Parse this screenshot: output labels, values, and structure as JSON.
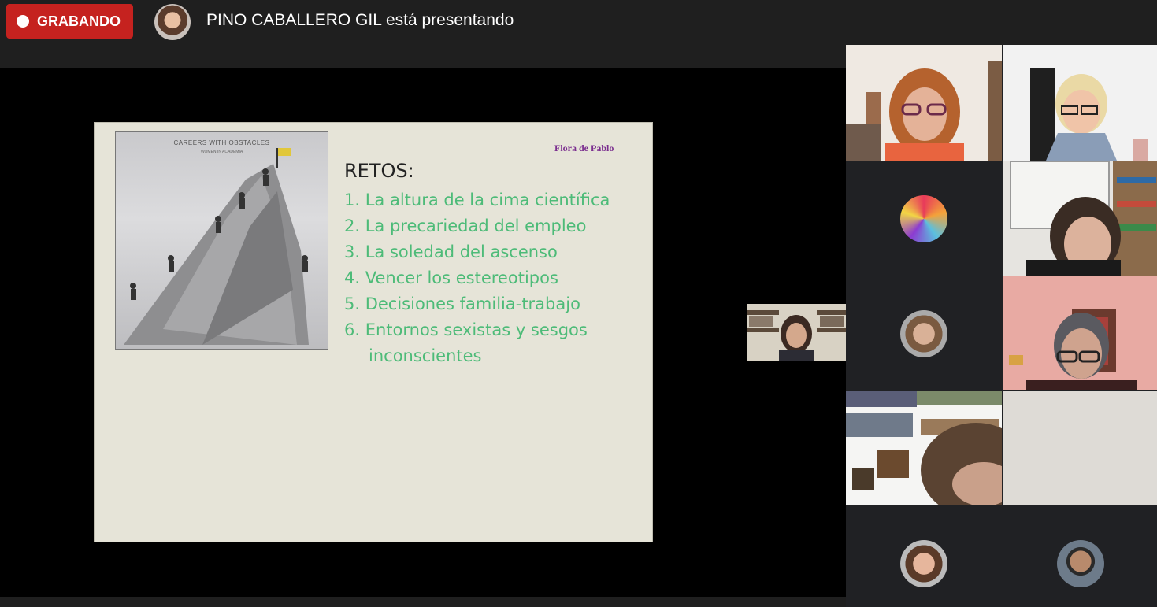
{
  "recording": {
    "label": "GRABANDO",
    "color": "#c5221f"
  },
  "presenter": {
    "banner": "PINO CABALLERO GIL está presentando"
  },
  "slide": {
    "book_title": "CAREERS WITH OBSTACLES",
    "book_subtitle": "WOMEN IN ACADEMIA",
    "author": "Flora de Pablo",
    "heading": "RETOS:",
    "items": [
      "1. La altura de la cima científica",
      "2. La precariedad del empleo",
      "3. La soledad del ascenso",
      "4. Vencer los estereotipos",
      "5. Decisiones  familia-trabajo",
      "6. Entornos sexistas y sesgos",
      "inconscientes"
    ],
    "item_color": "#4dbb78"
  },
  "participants": [
    {
      "tile": "video",
      "icon": "participant-video"
    },
    {
      "tile": "video",
      "icon": "participant-video"
    },
    {
      "tile": "avatar",
      "icon": "colorful-avatar-icon"
    },
    {
      "tile": "video",
      "icon": "participant-video"
    },
    {
      "tile": "avatar",
      "icon": "photo-avatar"
    },
    {
      "tile": "video",
      "icon": "participant-video"
    },
    {
      "tile": "video",
      "icon": "participant-video"
    },
    {
      "tile": "video",
      "icon": "participant-video"
    },
    {
      "tile": "avatar",
      "icon": "photo-avatar"
    },
    {
      "tile": "avatar",
      "icon": "photo-avatar"
    }
  ]
}
